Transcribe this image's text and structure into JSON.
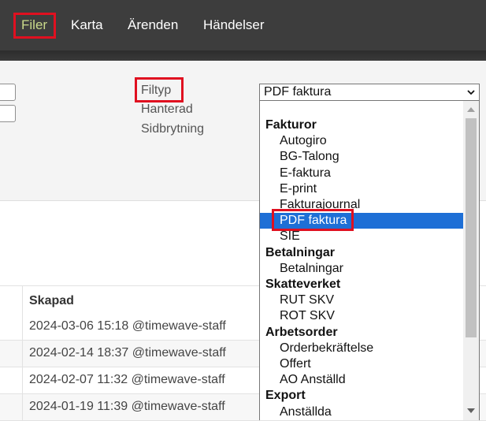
{
  "nav": {
    "items": [
      "Filer",
      "Karta",
      "Ärenden",
      "Händelser"
    ],
    "active_color": "#c9d98a",
    "highlight_color": "#e01020"
  },
  "filters": {
    "labels": [
      "Filtyp",
      "Hanterad",
      "Sidbrytning"
    ],
    "filetype_select": {
      "value": "PDF faktura",
      "icon": "chevron-down-icon"
    }
  },
  "dropdown": {
    "selected_color": "#1e6fd6",
    "options": [
      {
        "type": "group",
        "label": "Fakturor"
      },
      {
        "type": "item",
        "label": "Autogiro"
      },
      {
        "type": "item",
        "label": "BG-Talong"
      },
      {
        "type": "item",
        "label": "E-faktura"
      },
      {
        "type": "item",
        "label": "E-print"
      },
      {
        "type": "item",
        "label": "Fakturajournal"
      },
      {
        "type": "item",
        "label": "PDF faktura",
        "selected": true
      },
      {
        "type": "item",
        "label": "SIE"
      },
      {
        "type": "group",
        "label": "Betalningar"
      },
      {
        "type": "item",
        "label": "Betalningar"
      },
      {
        "type": "group",
        "label": "Skatteverket"
      },
      {
        "type": "item",
        "label": "RUT SKV"
      },
      {
        "type": "item",
        "label": "ROT SKV"
      },
      {
        "type": "group",
        "label": "Arbetsorder"
      },
      {
        "type": "item",
        "label": "Orderbekräftelse"
      },
      {
        "type": "item",
        "label": "Offert"
      },
      {
        "type": "item",
        "label": "AO Anställd"
      },
      {
        "type": "group",
        "label": "Export"
      },
      {
        "type": "item",
        "label": "Anställda"
      }
    ]
  },
  "table": {
    "column_header": "Skapad",
    "rows": [
      "2024-03-06 15:18 @timewave-staff",
      "2024-02-14 18:37 @timewave-staff",
      "2024-02-07 11:32 @timewave-staff",
      "2024-01-19 11:39 @timewave-staff"
    ]
  }
}
